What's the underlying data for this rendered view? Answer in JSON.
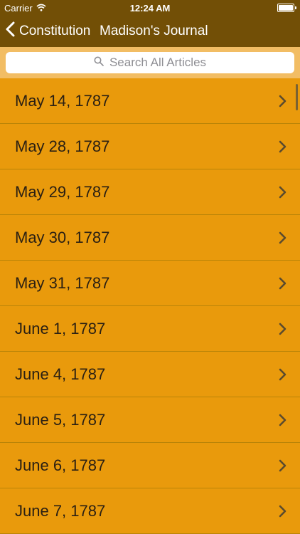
{
  "status": {
    "carrier": "Carrier",
    "time": "12:24 AM"
  },
  "nav": {
    "back_label": "Constitution",
    "title": "Madison's Journal"
  },
  "search": {
    "placeholder": "Search All Articles",
    "icon": "search-icon"
  },
  "colors": {
    "nav_bg": "#724f06",
    "list_bg": "#e99a0c",
    "search_bg": "#f2bd64",
    "separator": "#b98408"
  },
  "items": [
    {
      "label": "May 14, 1787"
    },
    {
      "label": "May 28, 1787"
    },
    {
      "label": "May 29, 1787"
    },
    {
      "label": "May 30, 1787"
    },
    {
      "label": "May 31, 1787"
    },
    {
      "label": "June 1, 1787"
    },
    {
      "label": "June 4, 1787"
    },
    {
      "label": "June 5, 1787"
    },
    {
      "label": "June 6, 1787"
    },
    {
      "label": "June 7, 1787"
    }
  ]
}
